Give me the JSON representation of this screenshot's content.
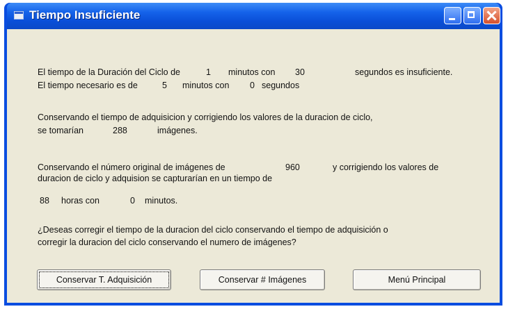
{
  "window": {
    "title": "Tiempo Insuficiente"
  },
  "line1": {
    "prefix": "El tiempo de la Duración del Ciclo de",
    "minutes": "1",
    "mid": "minutos con",
    "seconds": "30",
    "suffix": "segundos es insuficiente."
  },
  "line2": {
    "prefix": "El tiempo necesario es de",
    "minutes": "5",
    "mid": "minutos con",
    "seconds": "0",
    "suffix": "segundos"
  },
  "para1": {
    "line1": "Conservando el tiempo de adquisicion y corrigiendo los valores de la duracion de ciclo,",
    "prefix": "se tomarían",
    "images": "288",
    "suffix": "imágenes."
  },
  "para2": {
    "prefix": "Conservando el número original de imágenes de",
    "images": "960",
    "suffix": "y corrigiendo los valores de",
    "line2": "duracion de ciclo y adquision se capturarían  en  un tiempo de",
    "hours": "88",
    "hours_label": "horas con",
    "minutes": "0",
    "minutes_label": "minutos."
  },
  "question": {
    "line1": "¿Deseas corregir el tiempo de la duracion del ciclo  conservando el tiempo de adquisición o",
    "line2": "corregir la duracion del ciclo conservando el numero de imágenes?"
  },
  "buttons": {
    "keep_acquisition": "Conservar T. Adquisición",
    "keep_images": "Conservar # Imágenes",
    "main_menu": "Menú Principal"
  }
}
